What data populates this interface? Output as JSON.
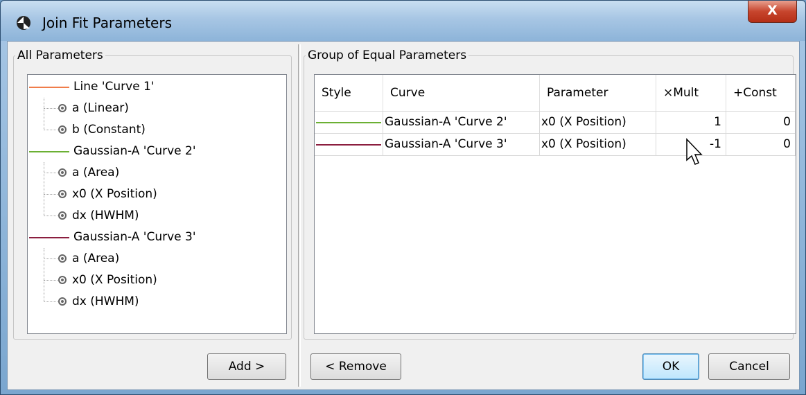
{
  "window": {
    "title": "Join Fit Parameters",
    "close_label": "X"
  },
  "left": {
    "group_title": "All Parameters",
    "tree": [
      {
        "label": "Line 'Curve 1'",
        "color": "#f07d4a",
        "params": [
          "a (Linear)",
          "b (Constant)"
        ]
      },
      {
        "label": "Gaussian-A 'Curve 2'",
        "color": "#6bb033",
        "params": [
          "a (Area)",
          "x0 (X Position)",
          "dx (HWHM)"
        ]
      },
      {
        "label": "Gaussian-A 'Curve 3'",
        "color": "#8b1e3f",
        "params": [
          "a (Area)",
          "x0 (X Position)",
          "dx (HWHM)"
        ]
      }
    ],
    "add_button": "Add >"
  },
  "right": {
    "group_title": "Group of Equal Parameters",
    "columns": [
      "Style",
      "Curve",
      "Parameter",
      "×Mult",
      "+Const"
    ],
    "rows": [
      {
        "style_color": "#6bb033",
        "curve": "Gaussian-A 'Curve 2'",
        "parameter": "x0 (X Position)",
        "mult": "1",
        "const": "0"
      },
      {
        "style_color": "#8b1e3f",
        "curve": "Gaussian-A 'Curve 3'",
        "parameter": "x0 (X Position)",
        "mult": "-1",
        "const": "0"
      }
    ],
    "remove_button": "< Remove",
    "ok_button": "OK",
    "cancel_button": "Cancel"
  }
}
